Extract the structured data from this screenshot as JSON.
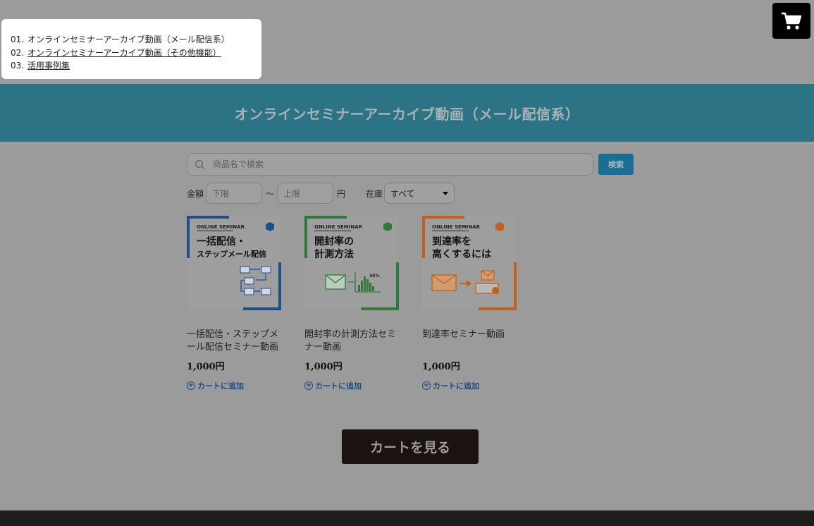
{
  "nav": {
    "items": [
      {
        "num": "01.",
        "label": "オンラインセミナーアーカイブ動画（メール配信系）"
      },
      {
        "num": "02.",
        "label": "オンラインセミナーアーカイブ動画（その他機能）"
      },
      {
        "num": "03.",
        "label": "活用事例集"
      }
    ]
  },
  "banner": {
    "title": "オンラインセミナーアーカイブ動画（メール配信系）"
  },
  "search": {
    "placeholder": "商品名で検索",
    "button": "検索"
  },
  "filter": {
    "price_label": "金額",
    "min_placeholder": "下限",
    "tilde": "～",
    "max_placeholder": "上限",
    "unit": "円",
    "stock_label": "在庫",
    "stock_selected": "すべて"
  },
  "products": [
    {
      "thumb_tag": "ONLINE SEMINAR",
      "thumb_title_1": "一括配信・",
      "thumb_title_2": "ステップメール配信",
      "name": "一括配信・ステップメール配信セミナー動画",
      "price": "1,000円",
      "add_label": "カートに追加",
      "accent": "#1d4f8a"
    },
    {
      "thumb_tag": "ONLINE SEMINAR",
      "thumb_title_1": "開封率の",
      "thumb_title_2": "計測方法",
      "thumb_percent": "35%",
      "name": "開封率の計測方法セミナー動画",
      "price": "1,000円",
      "add_label": "カートに追加",
      "accent": "#2e7a3a"
    },
    {
      "thumb_tag": "ONLINE SEMINAR",
      "thumb_title_1": "到達率を",
      "thumb_title_2": "高くするには",
      "name": "到達率セミナー動画",
      "price": "1,000円",
      "add_label": "カートに追加",
      "accent": "#c0601a"
    }
  ],
  "view_cart": "カートを見る",
  "colors": {
    "overlay_bg": "#9b9b9b",
    "banner_bg": "#2b7385",
    "search_button_bg": "#1a6e93",
    "view_cart_bg": "#1a1311",
    "link_blue": "#1f4c84"
  },
  "icons": {
    "cart": "cart-icon",
    "search": "search-icon",
    "add": "plus-circle-icon"
  }
}
